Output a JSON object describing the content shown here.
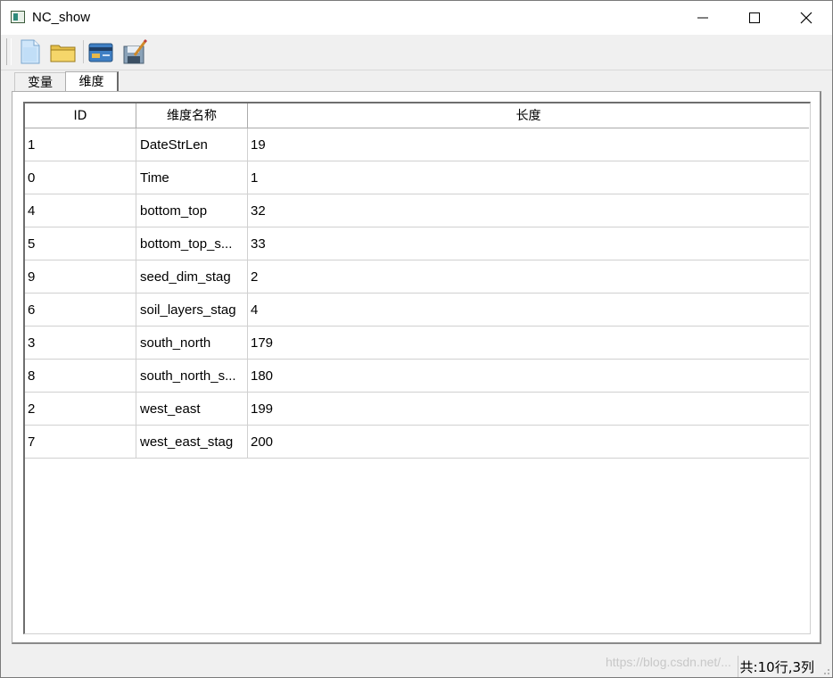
{
  "window": {
    "title": "NC_show"
  },
  "toolbar": {
    "buttons": [
      {
        "name": "new-file",
        "icon": "document-icon"
      },
      {
        "name": "open-folder",
        "icon": "folder-icon"
      },
      {
        "name": "card",
        "icon": "card-icon"
      },
      {
        "name": "save-edit",
        "icon": "save-icon"
      }
    ]
  },
  "tabs": [
    {
      "label": "变量",
      "active": false
    },
    {
      "label": "维度",
      "active": true
    }
  ],
  "table": {
    "headers": [
      "ID",
      "维度名称",
      "长度"
    ],
    "rows": [
      {
        "id": "1",
        "name": "DateStrLen",
        "length": "19"
      },
      {
        "id": "0",
        "name": "Time",
        "length": "1"
      },
      {
        "id": "4",
        "name": "bottom_top",
        "length": "32"
      },
      {
        "id": "5",
        "name": "bottom_top_s...",
        "length": "33"
      },
      {
        "id": "9",
        "name": "seed_dim_stag",
        "length": "2"
      },
      {
        "id": "6",
        "name": "soil_layers_stag",
        "length": "4"
      },
      {
        "id": "3",
        "name": "south_north",
        "length": "179"
      },
      {
        "id": "8",
        "name": "south_north_s...",
        "length": "180"
      },
      {
        "id": "2",
        "name": "west_east",
        "length": "199"
      },
      {
        "id": "7",
        "name": "west_east_stag",
        "length": "200"
      }
    ]
  },
  "status": {
    "summary": "共:10行,3列",
    "watermark": "https://blog.csdn.net/..."
  },
  "colors": {
    "window_bg": "#f0f0f0",
    "pane_bg": "#ffffff",
    "grid_line": "#d0d0d0"
  }
}
